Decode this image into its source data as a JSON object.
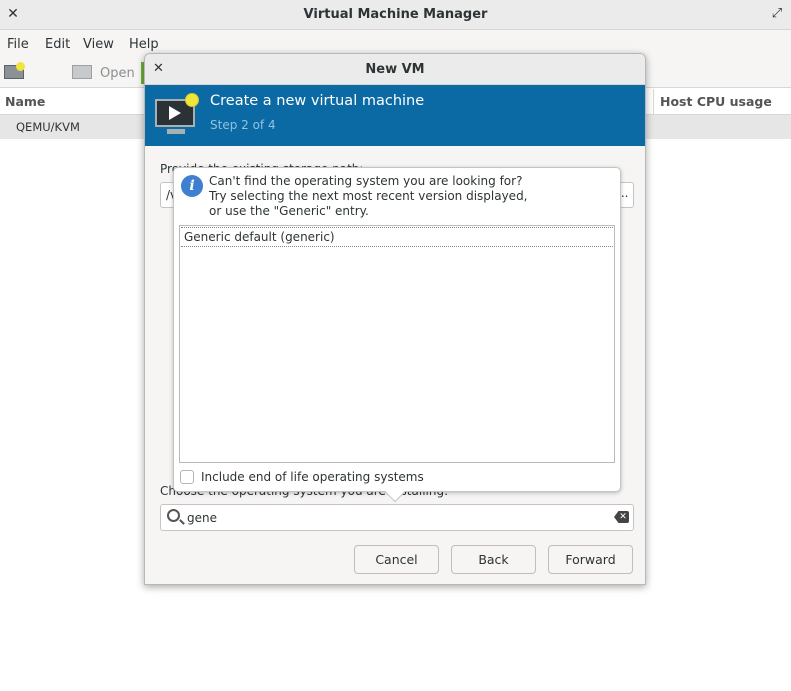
{
  "main_window": {
    "title": "Virtual Machine Manager",
    "menu": [
      "File",
      "Edit",
      "View",
      "Help"
    ],
    "toolbar": {
      "open_label": "Open"
    },
    "columns": {
      "name": "Name",
      "cpu": "Host CPU usage"
    },
    "connection": "QEMU/KVM"
  },
  "dialog": {
    "title": "New VM",
    "banner_title": "Create a new virtual machine",
    "banner_step": "Step 2 of 4",
    "storage_label": "Provide the existing storage path:",
    "storage_value": "/v",
    "browse_label": "...",
    "os_label": "Choose the operating system you are installing:",
    "search_value": "gene",
    "buttons": {
      "cancel": "Cancel",
      "back": "Back",
      "forward": "Forward"
    }
  },
  "popover": {
    "info_lines": [
      "Can't find the operating system you are looking for?",
      "Try selecting the next most recent version displayed,",
      "or use the \"Generic\" entry."
    ],
    "os_items": [
      "Generic default (generic)"
    ],
    "eol_label": "Include end of life operating systems",
    "eol_checked": false
  }
}
